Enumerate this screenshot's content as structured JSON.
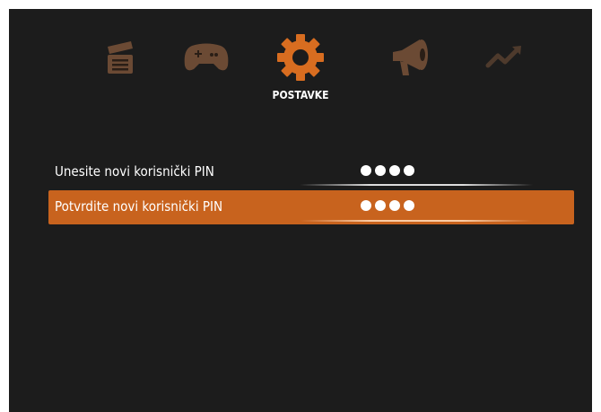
{
  "menu": {
    "active_label": "POSTAVKE",
    "items": [
      {
        "icon": "clapperboard-icon"
      },
      {
        "icon": "gamepad-icon"
      },
      {
        "icon": "gear-icon",
        "active": true
      },
      {
        "icon": "megaphone-icon"
      },
      {
        "icon": "trending-up-icon"
      }
    ]
  },
  "form": {
    "new_pin_label": "Unesite novi korisnički PIN",
    "new_pin_masked": "●●●●",
    "confirm_pin_label": "Potvrdite novi korisnički PIN",
    "confirm_pin_masked": "●●●●"
  },
  "colors": {
    "background": "#1c1c1c",
    "accent": "#c8631e",
    "inactive_icon": "#6b4a34"
  }
}
